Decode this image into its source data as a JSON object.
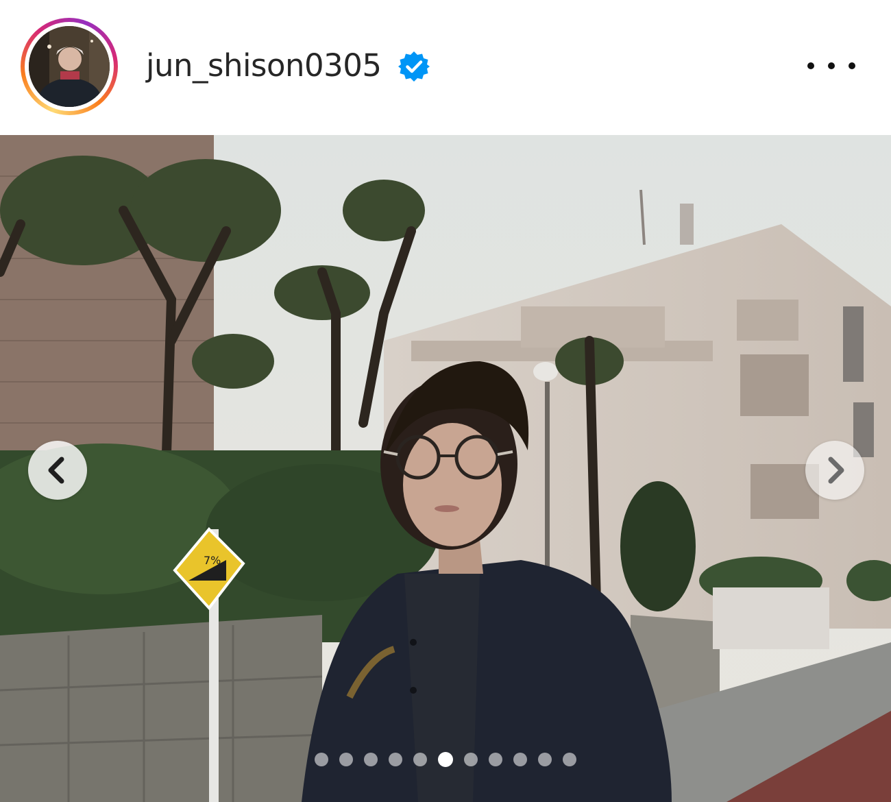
{
  "post": {
    "username": "jun_shison0305",
    "verified": true,
    "more_icon": "more-horizontal-icon"
  },
  "carousel": {
    "prev_icon": "chevron-left-icon",
    "next_icon": "chevron-right-icon",
    "slide_count": 11,
    "active_slide": 6
  },
  "photo": {
    "sign_text": "7%"
  },
  "colors": {
    "verified_blue": "#0095f6",
    "text": "#262626"
  }
}
